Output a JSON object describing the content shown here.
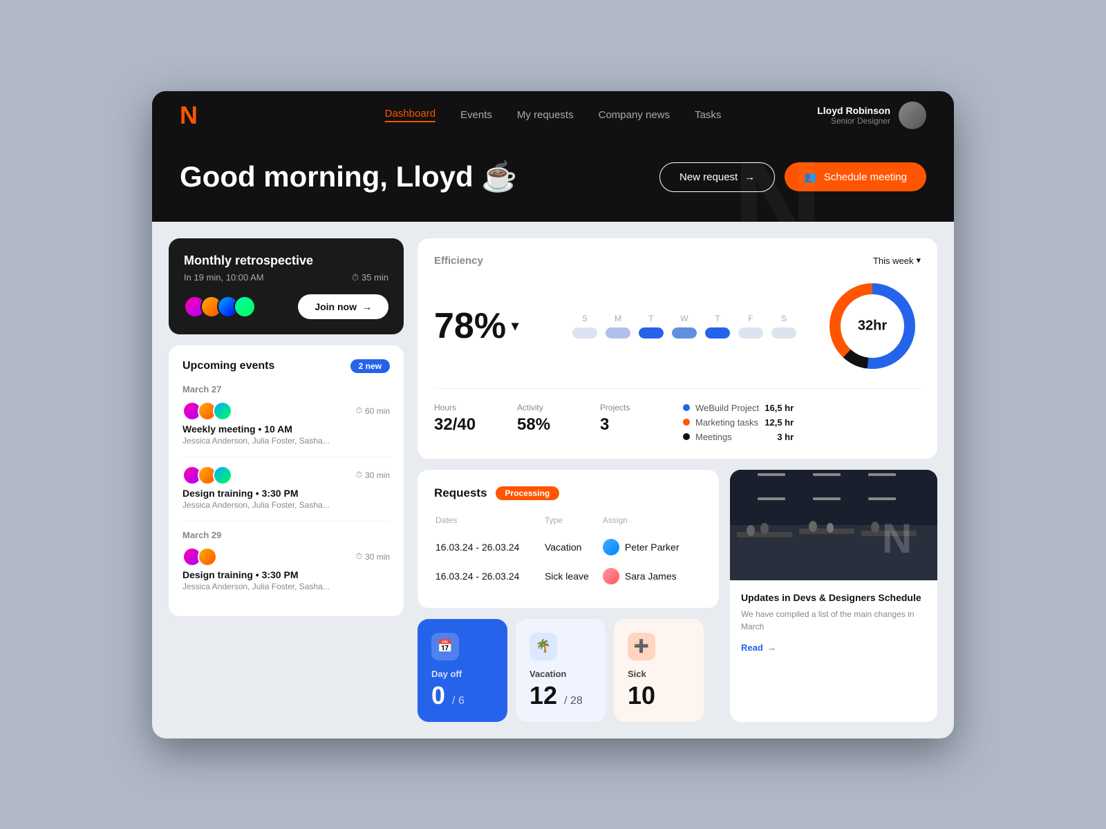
{
  "header": {
    "logo": "N",
    "nav": [
      {
        "label": "Dashboard",
        "active": true
      },
      {
        "label": "Events",
        "active": false
      },
      {
        "label": "My requests",
        "active": false
      },
      {
        "label": "Company news",
        "active": false
      },
      {
        "label": "Tasks",
        "active": false
      }
    ],
    "user": {
      "name": "Lloyd Robinson",
      "role": "Senior Designer"
    }
  },
  "hero": {
    "greeting": "Good morning, Lloyd ☕",
    "bg_letter": "N",
    "new_request_label": "New request",
    "schedule_label": "Schedule meeting"
  },
  "meeting": {
    "title": "Monthly retrospective",
    "time": "In 19 min, 10:00 AM",
    "duration": "35 min",
    "join_label": "Join now"
  },
  "upcoming_events": {
    "title": "Upcoming events",
    "badge": "2 new",
    "dates": [
      {
        "label": "March 27",
        "events": [
          {
            "duration": "60 min",
            "name": "Weekly meeting • 10 AM",
            "participants": "Jessica Anderson, Julia Foster, Sasha..."
          },
          {
            "duration": "30 min",
            "name": "Design training • 3:30 PM",
            "participants": "Jessica Anderson, Julia Foster, Sasha..."
          }
        ]
      },
      {
        "label": "March 29",
        "events": [
          {
            "duration": "30 min",
            "name": "Design training • 3:30 PM",
            "participants": "Jessica Anderson, Julia Foster, Sasha..."
          }
        ]
      }
    ]
  },
  "efficiency": {
    "title": "Efficiency",
    "period": "This week",
    "percent": "78%",
    "days": [
      {
        "label": "S",
        "fill": 15,
        "color": "#dde3f0"
      },
      {
        "label": "M",
        "fill": 60,
        "color": "#b0c0e8"
      },
      {
        "label": "T",
        "fill": 85,
        "color": "#2563eb"
      },
      {
        "label": "W",
        "fill": 70,
        "color": "#6090dd"
      },
      {
        "label": "T",
        "fill": 90,
        "color": "#2563eb"
      },
      {
        "label": "F",
        "fill": 20,
        "color": "#dde3f0"
      },
      {
        "label": "S",
        "fill": 10,
        "color": "#dde3f0"
      }
    ],
    "stats": {
      "hours_label": "Hours",
      "hours_value": "32/40",
      "activity_label": "Activity",
      "activity_value": "58%",
      "projects_label": "Projects",
      "projects_value": "3"
    },
    "legend": [
      {
        "color": "#2563eb",
        "label": "WeBuild Project",
        "value": "16,5 hr"
      },
      {
        "color": "#ff5500",
        "label": "Marketing tasks",
        "value": "12,5 hr"
      },
      {
        "color": "#111",
        "label": "Meetings",
        "value": "3 hr"
      }
    ],
    "donut": {
      "center": "32hr",
      "segments": [
        {
          "color": "#2563eb",
          "pct": 52
        },
        {
          "color": "#111",
          "pct": 10
        },
        {
          "color": "#ff5500",
          "pct": 38
        }
      ]
    }
  },
  "requests": {
    "title": "Requests",
    "status": "Processing",
    "columns": [
      "Dates",
      "Type",
      "Assign"
    ],
    "rows": [
      {
        "dates": "16.03.24 - 26.03.24",
        "type": "Vacation",
        "assign": "Peter Parker"
      },
      {
        "dates": "16.03.24 - 26.03.24",
        "type": "Sick leave",
        "assign": "Sara James"
      }
    ]
  },
  "stats_cards": [
    {
      "type": "blue",
      "icon": "📅",
      "label": "Day off",
      "number": "0",
      "denom": "/ 6"
    },
    {
      "type": "light",
      "icon": "🌴",
      "label": "Vacation",
      "number": "12",
      "denom": "/ 28"
    },
    {
      "type": "peach",
      "icon": "➕",
      "label": "Sick",
      "number": "10",
      "denom": ""
    }
  ],
  "news": {
    "title": "Updates in Devs & Designers Schedule",
    "description": "We have compiled a list of the main changes in March",
    "read_label": "Read"
  }
}
